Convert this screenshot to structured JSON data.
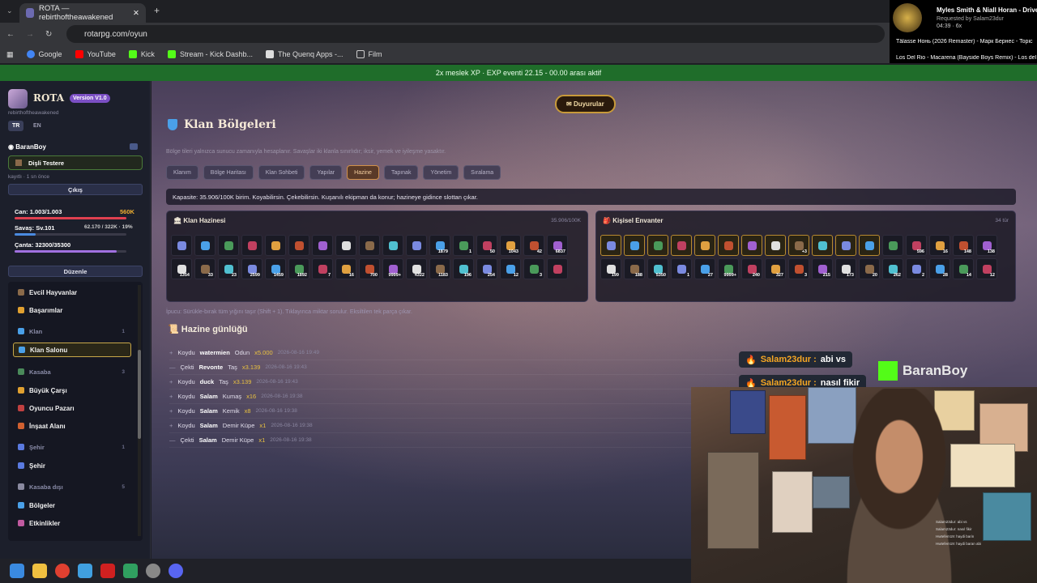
{
  "browser": {
    "tab_title": "ROTA — rebirthoftheawakened",
    "url": "rotarpg.com/oyun",
    "bookmarks": [
      "Google",
      "YouTube",
      "Kick",
      "Stream - Kick Dashb...",
      "The Quenq Apps -...",
      "Film"
    ]
  },
  "media": {
    "title": "Myles Smith & Niall Horan - Drive Sa",
    "requested": "Requested by Salam23dur",
    "time": "04:39",
    "count": "6x",
    "queue": [
      "Tälasse Нонь (2026 Remaster) - Марк Бернес - Topic",
      "Los Del Rio - Macarena (Bayside Boys Remix) - Los del Rio Official"
    ]
  },
  "banner": "2x meslek XP · EXP eventi 22.15 - 00.00 arası aktif",
  "sidebar": {
    "brand": "ROTA",
    "version": "Version V1.0",
    "subtitle": "rebirthoftheawakened",
    "lang_tr": "TR",
    "lang_en": "EN",
    "username": "BaranBoy",
    "tool": "Dişli Testere",
    "tool_meta": "kayıtlı · 1 sn önce",
    "logout": "Çıkış",
    "can": "Can: 1.003/1.003",
    "gold": "560K",
    "savas": "Savaş: Sv.101",
    "savas_xp": "62.170 / 322K · 19%",
    "canta": "Çanta: 32300/35300",
    "edit": "Düzenle",
    "nav": [
      {
        "label": "Evcil Hayvanlar",
        "type": "item",
        "color": "#8a6a4a"
      },
      {
        "label": "Başarımlar",
        "type": "item",
        "color": "#e0a030"
      },
      {
        "label": "Klan",
        "type": "cat",
        "count": "1",
        "color": "#4aa0e8"
      },
      {
        "label": "Klan Salonu",
        "type": "sel",
        "color": "#4aa0e8"
      },
      {
        "label": "Kasaba",
        "type": "cat",
        "count": "3",
        "color": "#4a8a5a"
      },
      {
        "label": "Büyük Çarşı",
        "type": "item",
        "color": "#e0a030"
      },
      {
        "label": "Oyuncu Pazarı",
        "type": "item",
        "color": "#c04040"
      },
      {
        "label": "İnşaat Alanı",
        "type": "item",
        "color": "#d06030"
      },
      {
        "label": "Şehir",
        "type": "cat",
        "count": "1",
        "color": "#5a7ae0"
      },
      {
        "label": "Şehir",
        "type": "item",
        "color": "#5a7ae0"
      },
      {
        "label": "Kasaba dışı",
        "type": "cat",
        "count": "5",
        "color": "#8a8aa0"
      },
      {
        "label": "Bölgeler",
        "type": "item",
        "color": "#4aa0e8"
      },
      {
        "label": "Etkinlikler",
        "type": "item",
        "color": "#c05aa0"
      }
    ]
  },
  "main": {
    "announce": "Duyurular",
    "title": "Klan Bölgeleri",
    "desc": "Bölge tileri yalnızca sunucu zamanıyla hesaplanır. Savaşlar iki klanla sınırlıdır; iksir, yemek ve iyileşme yasaktır.",
    "tabs": [
      "Klanım",
      "Bölge Haritası",
      "Klan Sohbeti",
      "Yapılar",
      "Hazine",
      "Tapınak",
      "Yönetim",
      "Sıralama"
    ],
    "capacity": "Kapasite: 35.906/100K birim. Koyabilirsin. Çekebilirsin. Kuşanılı ekipman da konur; hazineye gidince slottan çıkar.",
    "treasury": {
      "title": "Klan Hazinesi",
      "right": "35.906/100K",
      "slots": [
        [
          "",
          ""
        ],
        [
          "",
          ""
        ],
        [
          "",
          ""
        ],
        [
          "",
          ""
        ],
        [
          "",
          ""
        ],
        [
          "",
          ""
        ],
        [
          "",
          ""
        ],
        [
          "",
          ""
        ],
        [
          "",
          ""
        ],
        [
          "",
          ""
        ],
        [
          "",
          ""
        ],
        [
          "",
          "1879"
        ],
        [
          "",
          "1"
        ],
        [
          "",
          "50"
        ],
        [
          "",
          "1043"
        ],
        [
          "",
          "42"
        ],
        [
          "",
          "6837"
        ],
        [
          "",
          "1354"
        ],
        [
          "",
          "33"
        ],
        [
          "",
          "23"
        ],
        [
          "",
          "2599"
        ],
        [
          "",
          "1459"
        ],
        [
          "",
          "1892"
        ],
        [
          "",
          "7"
        ],
        [
          "",
          "16"
        ],
        [
          "",
          "700"
        ],
        [
          "",
          "9999+"
        ],
        [
          "",
          "4322"
        ],
        [
          "",
          "1183"
        ],
        [
          "",
          "196"
        ],
        [
          "",
          "254"
        ],
        [
          "",
          "12"
        ],
        [
          "",
          "3"
        ],
        [
          "",
          ""
        ]
      ]
    },
    "inventory": {
      "title": "Kişisel Envanter",
      "right": "34 tür",
      "slots": [
        [
          "g",
          ""
        ],
        [
          "g",
          ""
        ],
        [
          "g",
          ""
        ],
        [
          "g",
          ""
        ],
        [
          "g",
          ""
        ],
        [
          "g",
          ""
        ],
        [
          "g",
          ""
        ],
        [
          "g",
          ""
        ],
        [
          "g",
          "+3"
        ],
        [
          "g",
          ""
        ],
        [
          "g",
          ""
        ],
        [
          "g",
          ""
        ],
        [
          "",
          ""
        ],
        [
          "",
          "596"
        ],
        [
          "",
          "16"
        ],
        [
          "",
          "148"
        ],
        [
          "",
          "138"
        ],
        [
          "",
          "199"
        ],
        [
          "",
          "188"
        ],
        [
          "",
          "5350"
        ],
        [
          "",
          "1"
        ],
        [
          "",
          "27"
        ],
        [
          "",
          "9999+"
        ],
        [
          "",
          "240"
        ],
        [
          "",
          "327"
        ],
        [
          "",
          "3"
        ],
        [
          "",
          "215"
        ],
        [
          "",
          "173"
        ],
        [
          "",
          "20"
        ],
        [
          "",
          "262"
        ],
        [
          "",
          "2"
        ],
        [
          "",
          "28"
        ],
        [
          "",
          "14"
        ],
        [
          "",
          "12"
        ]
      ]
    },
    "tip": "İpucu: Sürükle-bırak tüm yığını taşır (Shift + 1). Tıklayınca miktar sorulur. Eksiltilen tek parça çıkar.",
    "log_title": "Hazine günlüğü",
    "log": [
      {
        "act": "Koydu",
        "who": "watermien",
        "item": "Odun",
        "amt": "x5.000",
        "ts": "2026-08-16 19:49"
      },
      {
        "act": "Çekti",
        "who": "Revonte",
        "item": "Taş",
        "amt": "x3.139",
        "ts": "2026-08-16 19:43"
      },
      {
        "act": "Koydu",
        "who": "duck",
        "item": "Taş",
        "amt": "x3.139",
        "ts": "2026-08-16 19:43"
      },
      {
        "act": "Koydu",
        "who": "Salam",
        "item": "Kumaş",
        "amt": "x16",
        "ts": "2026-08-16 19:38"
      },
      {
        "act": "Koydu",
        "who": "Salam",
        "item": "Kemik",
        "amt": "x8",
        "ts": "2026-08-16 19:38"
      },
      {
        "act": "Koydu",
        "who": "Salam",
        "item": "Demir Küpe",
        "amt": "x1",
        "ts": "2026-08-16 19:38"
      },
      {
        "act": "Çekti",
        "who": "Salam",
        "item": "Demir Küpe",
        "amt": "x1",
        "ts": "2026-08-16 19:38"
      }
    ]
  },
  "overlay": {
    "chat1_user": "Salam23dur :",
    "chat1_msg": "abi vs",
    "chat2_user": "Salam23dur :",
    "chat2_msg": "nasıl fikir",
    "kick_name": "BaranBoy",
    "minichat": [
      "Salam23dur: abi vs",
      "Salam23dur: nasıl fikir",
      "Hwtefem19: haydi barin",
      "Hwtefem19: haydi baran abi"
    ]
  }
}
